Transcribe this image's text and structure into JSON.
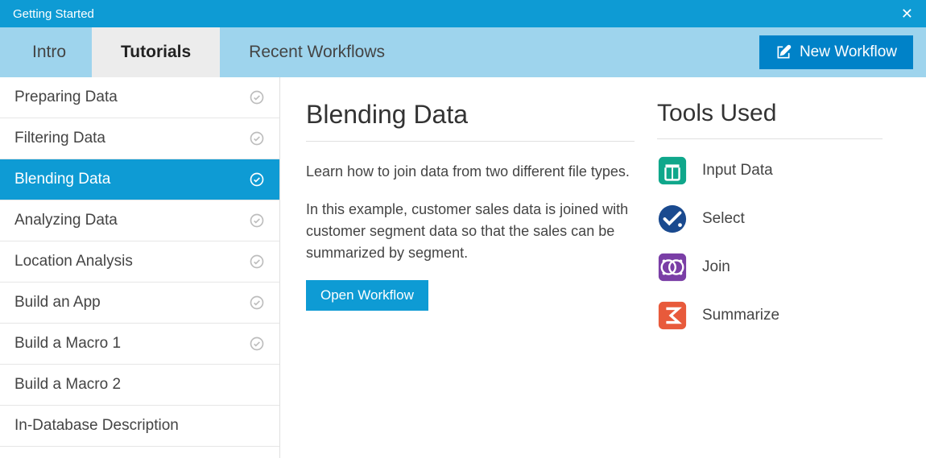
{
  "titlebar": {
    "title": "Getting Started"
  },
  "tabs": {
    "intro": "Intro",
    "tutorials": "Tutorials",
    "recent": "Recent Workflows"
  },
  "actions": {
    "new_workflow": "New Workflow",
    "open_workflow": "Open Workflow"
  },
  "sidebar": {
    "items": [
      {
        "label": "Preparing Data",
        "selected": false,
        "checked": true
      },
      {
        "label": "Filtering Data",
        "selected": false,
        "checked": true
      },
      {
        "label": "Blending Data",
        "selected": true,
        "checked": true
      },
      {
        "label": "Analyzing Data",
        "selected": false,
        "checked": true
      },
      {
        "label": "Location Analysis",
        "selected": false,
        "checked": true
      },
      {
        "label": "Build an App",
        "selected": false,
        "checked": true
      },
      {
        "label": "Build a Macro 1",
        "selected": false,
        "checked": true
      },
      {
        "label": "Build a Macro 2",
        "selected": false,
        "checked": false
      },
      {
        "label": "In-Database Description",
        "selected": false,
        "checked": false
      }
    ]
  },
  "detail": {
    "title": "Blending Data",
    "p1": "Learn how to join data from two different file types.",
    "p2": "In this example, customer sales data is joined with customer segment data so that the sales can be summarized by segment."
  },
  "tools": {
    "title": "Tools Used",
    "items": [
      {
        "label": "Input Data",
        "icon": "input-data-icon"
      },
      {
        "label": "Select",
        "icon": "select-icon"
      },
      {
        "label": "Join",
        "icon": "join-icon"
      },
      {
        "label": "Summarize",
        "icon": "summarize-icon"
      }
    ]
  }
}
